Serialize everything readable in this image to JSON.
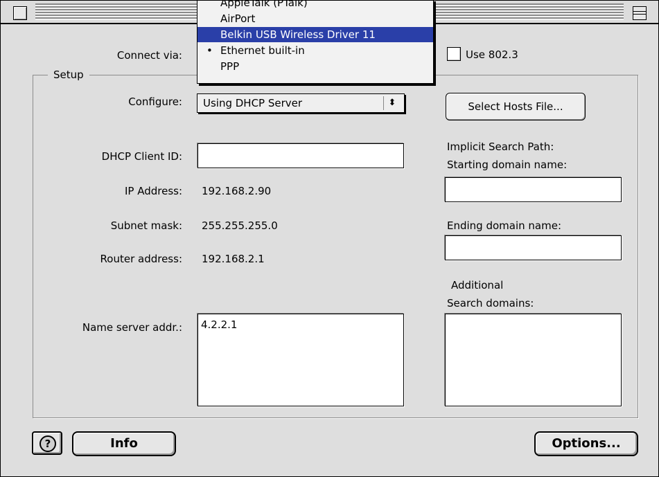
{
  "connect": {
    "label": "Connect via:",
    "menu": [
      {
        "label": "AppleTalk (PTalk)",
        "selected": false,
        "checked": false
      },
      {
        "label": "AirPort",
        "selected": false,
        "checked": false
      },
      {
        "label": "Belkin USB Wireless Driver 11",
        "selected": true,
        "checked": false
      },
      {
        "label": "Ethernet built-in",
        "selected": false,
        "checked": true
      },
      {
        "label": "PPP",
        "selected": false,
        "checked": false
      }
    ],
    "use8023_label": "Use 802.3",
    "use8023_checked": false
  },
  "setup": {
    "group_title": "Setup",
    "configure_label": "Configure:",
    "configure_value": "Using DHCP Server",
    "dhcp_label": "DHCP Client ID:",
    "dhcp_value": "",
    "ip_label": "IP Address:",
    "ip_value": "192.168.2.90",
    "subnet_label": "Subnet mask:",
    "subnet_value": "255.255.255.0",
    "router_label": "Router address:",
    "router_value": "192.168.2.1",
    "nameserver_label": "Name server addr.:",
    "nameserver_value": "4.2.2.1",
    "select_hosts_button": "Select Hosts File...",
    "implicit_line1": "Implicit Search Path:",
    "implicit_line2": "Starting domain name:",
    "starting_domain_value": "",
    "ending_label": "Ending domain name:",
    "ending_domain_value": "",
    "additional_line1": "Additional",
    "additional_line2": "Search domains:",
    "additional_value": ""
  },
  "footer": {
    "help_icon": "?",
    "info_button": "Info",
    "options_button": "Options..."
  }
}
